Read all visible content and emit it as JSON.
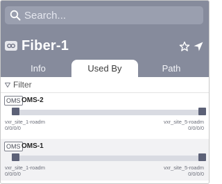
{
  "search": {
    "placeholder": "Search..."
  },
  "header": {
    "title": "Fiber-1",
    "type_icon": "link-icon",
    "actions": [
      {
        "name": "star-icon"
      },
      {
        "name": "navigation-arrow-icon"
      }
    ]
  },
  "tabs": [
    {
      "label": "Info",
      "active": false
    },
    {
      "label": "Used By",
      "active": true
    },
    {
      "label": "Path",
      "active": false
    }
  ],
  "filter": {
    "label": "Filter"
  },
  "used_by": [
    {
      "badge": "OMS",
      "name": "OMS-2",
      "left_site": "vxr_site_1-roadm",
      "left_port": "0/0/0/0",
      "right_site": "vxr_site_5-roadm",
      "right_port": "0/0/0/0"
    },
    {
      "badge": "OMS",
      "name": "OMS-1",
      "left_site": "vxr_site_1-roadm",
      "left_port": "0/0/0/0",
      "right_site": "vxr_site_5-roadm",
      "right_port": "0/0/0/0"
    }
  ],
  "colors": {
    "header_bg": "#868b9c",
    "node": "#5c6177",
    "track": "#d9dbe2"
  }
}
